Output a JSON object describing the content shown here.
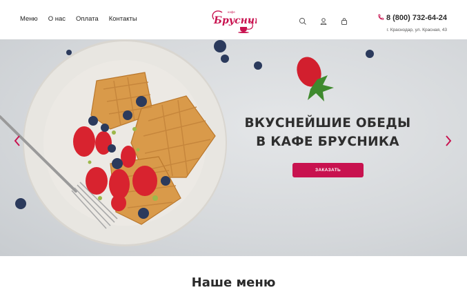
{
  "header": {
    "nav": [
      "Меню",
      "О нас",
      "Оплата",
      "Контакты"
    ],
    "logo_text": "Брусника",
    "logo_small": "кафе",
    "icons": [
      "search-icon",
      "user-icon",
      "cart-icon",
      "phone-icon"
    ],
    "phone": "8 (800) 732-64-24",
    "address": "г. Краснодар, ул. Красная, 43"
  },
  "hero": {
    "title_line1": "ВКУСНЕЙШИЕ ОБЕДЫ",
    "title_line2": "В КАФЕ БРУСНИКА",
    "cta_label": "ЗАКАЗАТЬ",
    "prev_icon": "chevron-left-icon",
    "next_icon": "chevron-right-icon"
  },
  "section": {
    "title": "Наше меню"
  },
  "colors": {
    "accent": "#c8124f",
    "text": "#222222",
    "hero_bg": "#d5d8db"
  }
}
